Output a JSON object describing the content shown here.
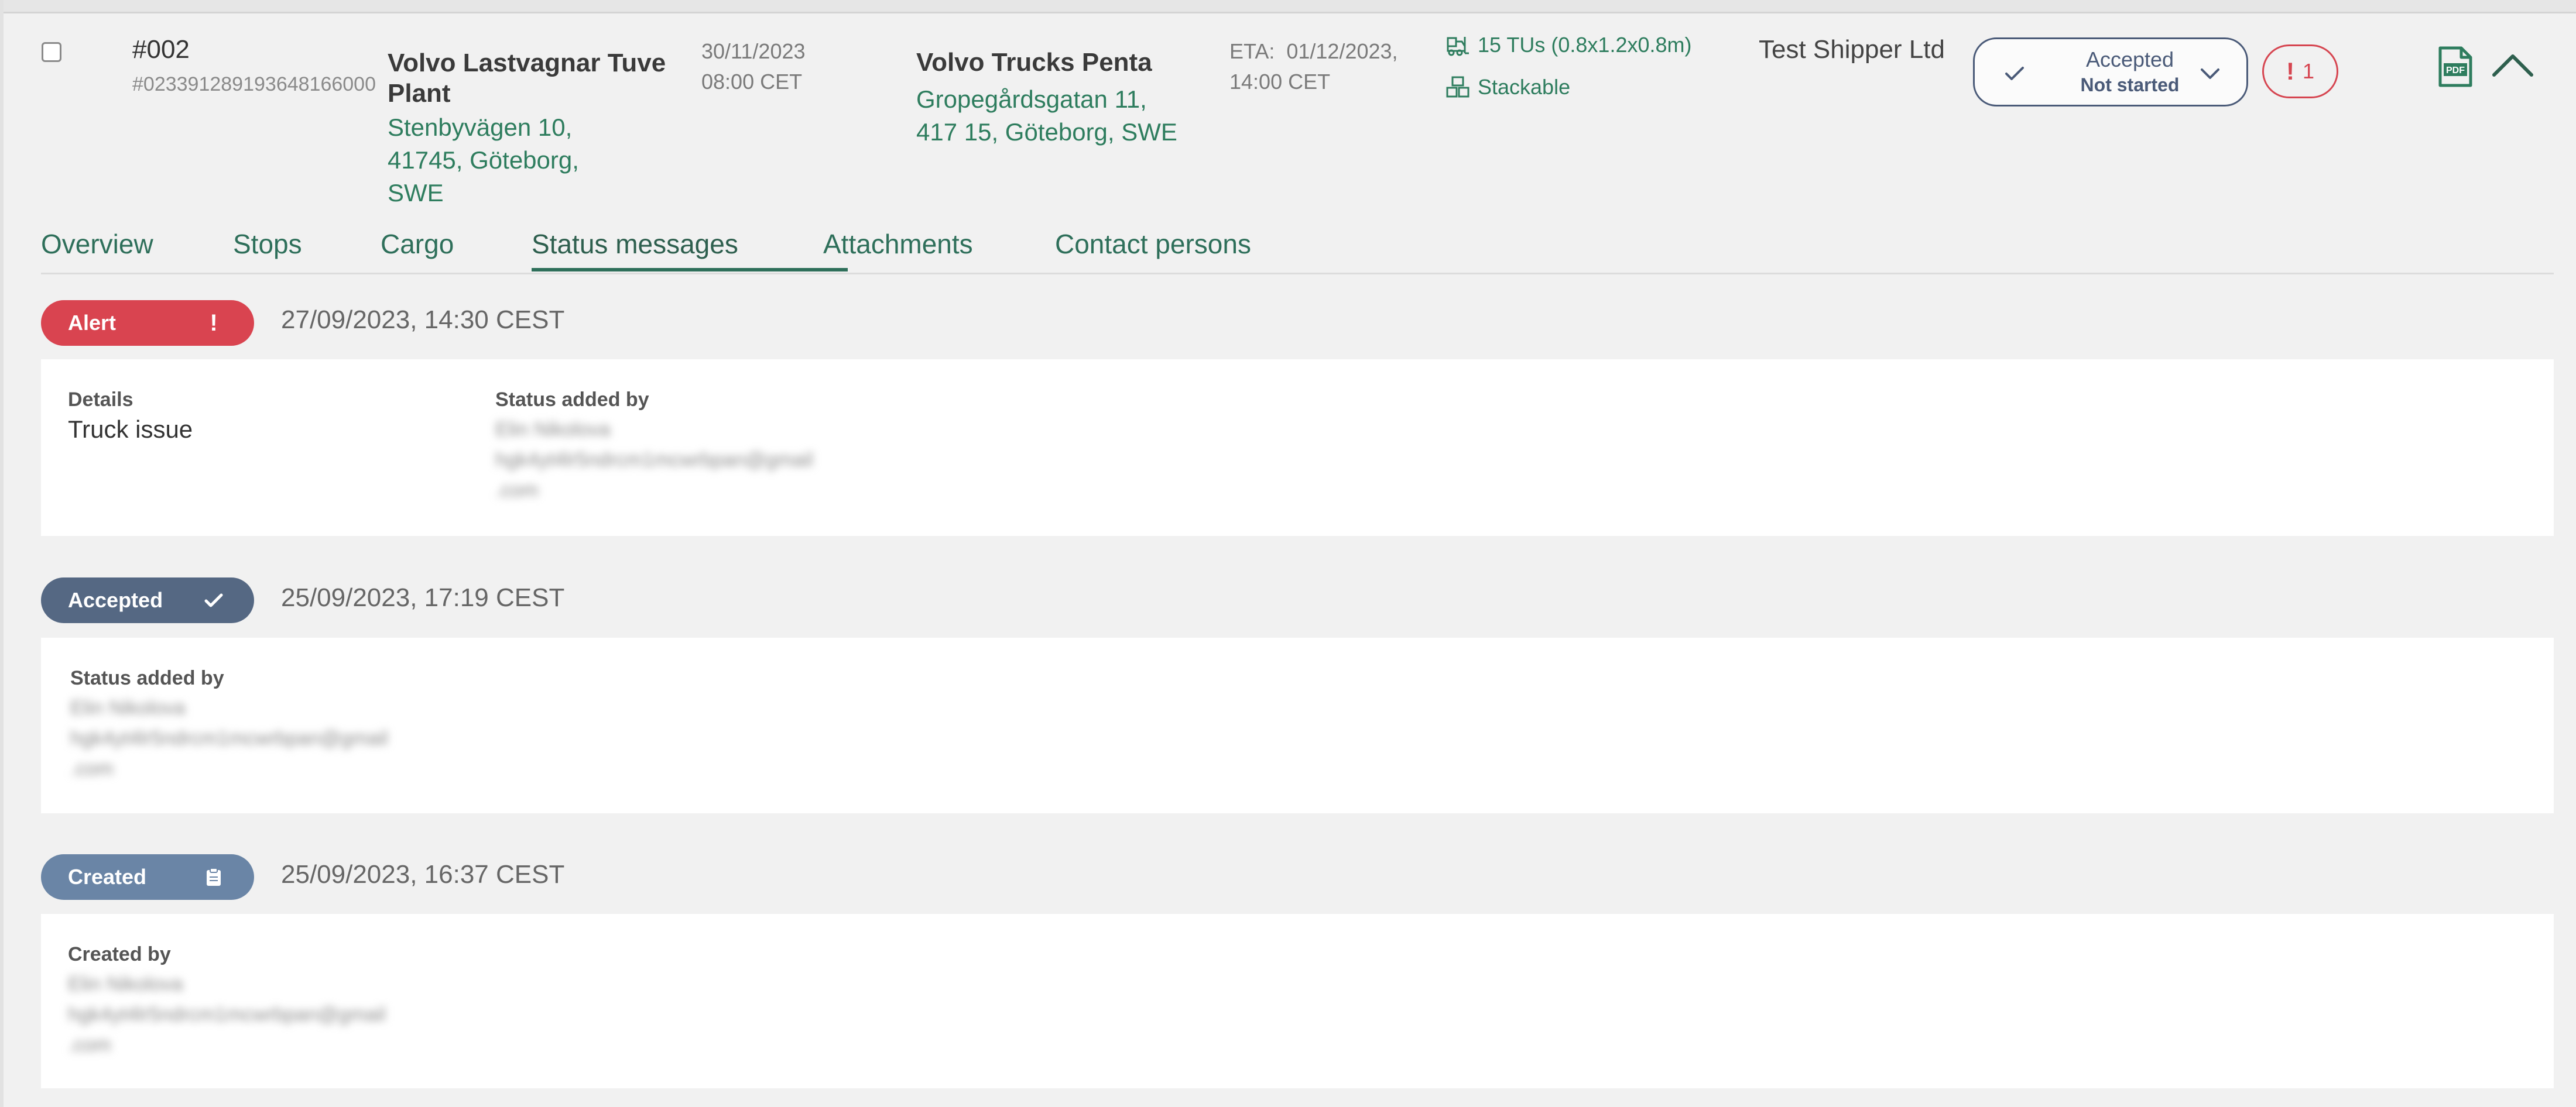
{
  "order": {
    "id": "#002",
    "reference": "#023391289193648166000",
    "pickup": {
      "name": "Volvo Lastvagnar Tuve Plant",
      "address_line1": "Stenbyvägen 10,",
      "address_line2": "41745, Göteborg, SWE",
      "date": "30/11/2023",
      "time": "08:00 CET"
    },
    "delivery": {
      "name": "Volvo Trucks Penta",
      "address_line1": "Gropegårdsgatan 11,",
      "address_line2": "417 15, Göteborg, SWE",
      "eta_label": "ETA:",
      "eta_date": "01/12/2023,",
      "eta_time": "14:00 CET"
    },
    "cargo": {
      "units": "15 TUs (0.8x1.2x0.8m)",
      "stackable": "Stackable"
    },
    "shipper": "Test Shipper Ltd",
    "status": {
      "primary": "Accepted",
      "secondary": "Not started"
    },
    "alerts": {
      "mark": "!",
      "count": "1"
    }
  },
  "tabs": [
    "Overview",
    "Stops",
    "Cargo",
    "Status messages",
    "Attachments",
    "Contact persons"
  ],
  "active_tab": "Status messages",
  "events": {
    "alert": {
      "badge": "Alert",
      "badge_mark": "!",
      "time": "27/09/2023, 14:30 CEST",
      "details_label": "Details",
      "details_value": "Truck issue",
      "added_by_label": "Status added by",
      "user_name": "Elin Nikolova",
      "user_email": "hgk4yt4lr5ndrcm1mcwrbpan@gmail",
      "user_domain": ".com"
    },
    "accepted": {
      "badge": "Accepted",
      "time": "25/09/2023, 17:19 CEST",
      "added_by_label": "Status added by",
      "user_name": "Elin Nikolova",
      "user_email": "hgk4yt4lr5ndrcm1mcwrbpan@gmail",
      "user_domain": ".com"
    },
    "created": {
      "badge": "Created",
      "time": "25/09/2023, 16:37 CEST",
      "created_by_label": "Created by",
      "user_name": "Elin Nikolova",
      "user_email": "hgk4yt4lr5ndrcm1mcwrbpan@gmail",
      "user_domain": ".com"
    }
  },
  "icons": {
    "checkbox": "checkbox-icon",
    "forklift": "forklift-icon",
    "stack": "stack-icon",
    "check": "check-icon",
    "chevron": "chevron-down-icon",
    "pdf": "pdf-icon",
    "collapse": "chevron-up-icon",
    "clipboard": "clipboard-icon"
  },
  "colors": {
    "accent_green": "#2e6f5a",
    "alert_red": "#d94450",
    "accepted_blue": "#556883",
    "created_blue": "#6a85a6"
  }
}
